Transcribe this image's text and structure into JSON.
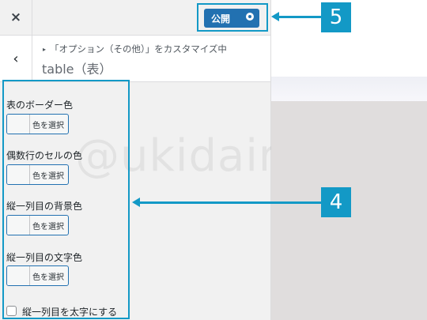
{
  "topbar": {
    "close_icon": "×",
    "publish_label": "公開",
    "publish_gear_icon": "gear-icon"
  },
  "section": {
    "back_icon": "‹",
    "breadcrumb": "「オプション（その他）」をカスタマイズ中",
    "title": "table（表）"
  },
  "controls": [
    {
      "label": "表のボーダー色",
      "button": "色を選択"
    },
    {
      "label": "偶数行のセルの色",
      "button": "色を選択"
    },
    {
      "label": "縦一列目の背景色",
      "button": "色を選択"
    },
    {
      "label": "縦一列目の文字色",
      "button": "色を選択"
    }
  ],
  "checkbox": {
    "label": "縦一列目を太字にする",
    "checked": false
  },
  "watermark": "@ukidaira",
  "annotations": {
    "badge_5": "5",
    "badge_4": "4"
  },
  "colors": {
    "accent": "#1399c6",
    "publish": "#2271b1",
    "panel": "#f1f1f1",
    "preview": "#e0dddd"
  }
}
